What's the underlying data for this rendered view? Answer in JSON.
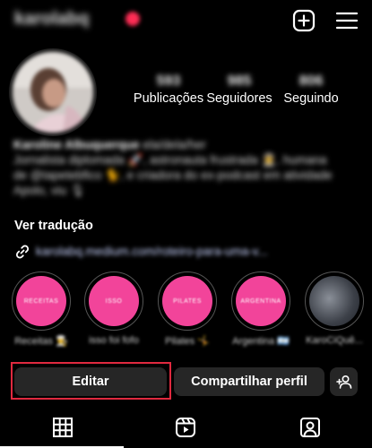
{
  "header": {
    "username": "karolabq",
    "plus_icon": "plus-square-icon",
    "menu_icon": "hamburger-menu-icon"
  },
  "profile": {
    "stats": [
      {
        "value": "593",
        "label": "Publicações"
      },
      {
        "value": "985",
        "label": "Seguidores"
      },
      {
        "value": "806",
        "label": "Seguindo"
      }
    ],
    "name": "Karoline Albuquerque",
    "handle_suffix": "ela/dela/her",
    "bio_line1": "Jornalista diplomada 🚀, astronauta frustrada 👩‍🚀, humana",
    "bio_line2": "de @tapetebfico 🐈, e criadora do ex-podcast em atividade",
    "bio_line3": "Apolo, viu 🎙",
    "translate_label": "Ver tradução",
    "link_text": "karolabq.medium.com/roteiro-para-uma-v..."
  },
  "highlights": [
    {
      "cover_text": "RECEITAS",
      "label": "Receitas 👨‍🍳"
    },
    {
      "cover_text": "ISSO",
      "label": "isso foi fofo"
    },
    {
      "cover_text": "PILATES",
      "label": "Pilates 🤸"
    },
    {
      "cover_text": "ARGENTINA",
      "label": "Argentina 🇦🇷"
    },
    {
      "cover_text": "",
      "label": "KaroCiQuê..."
    }
  ],
  "actions": {
    "edit_label": "Editar",
    "share_label": "Compartilhar perfil",
    "add_person_icon": "add-person-icon"
  },
  "tabs": [
    {
      "icon": "grid-icon"
    },
    {
      "icon": "reels-icon"
    },
    {
      "icon": "tagged-icon"
    }
  ],
  "colors": {
    "background": "#000000",
    "button": "#262626",
    "highlight_pink": "#f2449a",
    "annotation_red": "#e0293f",
    "live_dot": "#ff2d55"
  }
}
